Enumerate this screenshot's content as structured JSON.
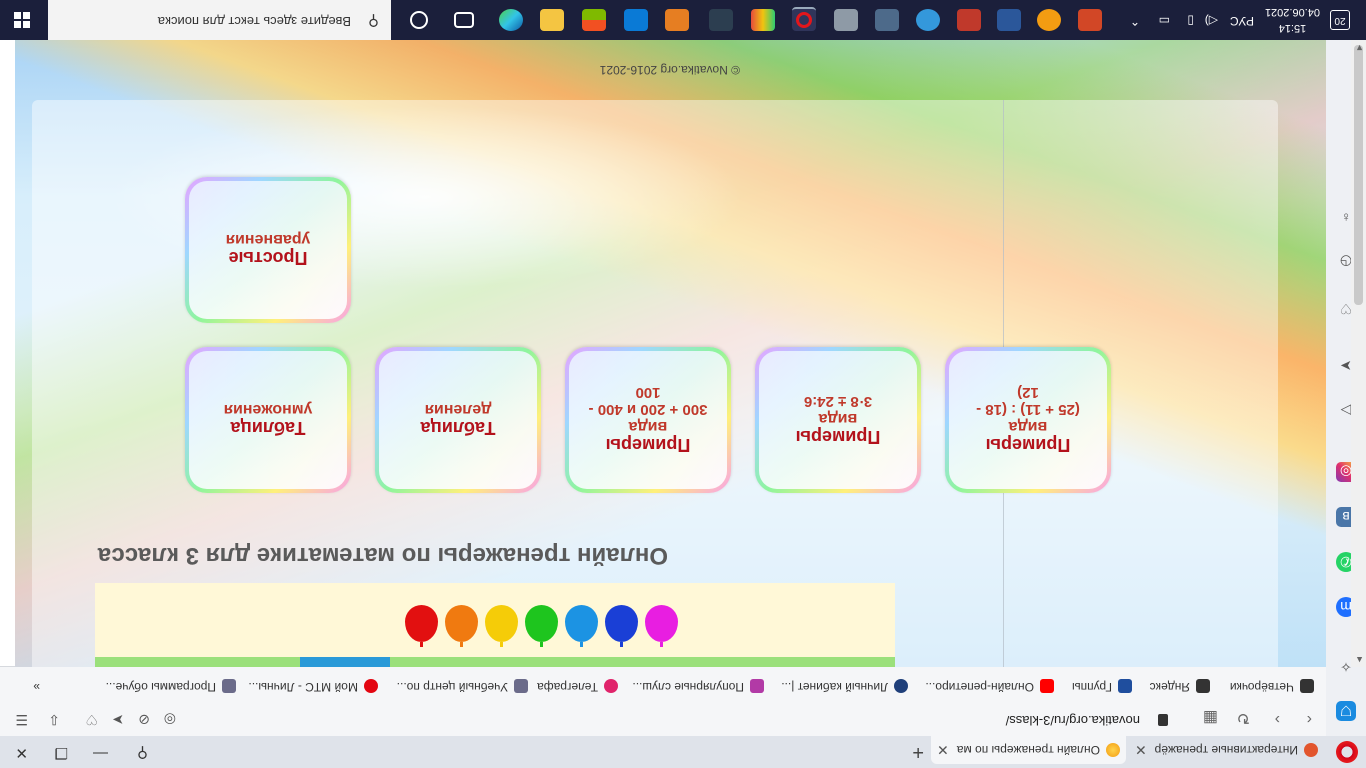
{
  "browser": {
    "tabs": [
      {
        "label": "Интерактивные тренажёр"
      },
      {
        "label": "Онлайн тренажеры по ма"
      }
    ],
    "url": "novatika.org/ru/3-klass/",
    "bookmarks": [
      {
        "label": "Четвёрочки",
        "color": "#333333"
      },
      {
        "label": "Яндекс",
        "color": "#333333"
      },
      {
        "label": "Группы",
        "color": "#1f4e9e"
      },
      {
        "label": "Онлайн-репетиро...",
        "color": "#ff0000"
      },
      {
        "label": "Личный кабинет |...",
        "color": "#1f3f7a"
      },
      {
        "label": "Популярные слуш...",
        "color": "#b23aa6"
      },
      {
        "label": "Телеграфа",
        "color": "#e0246b"
      },
      {
        "label": "Учебный центр по...",
        "color": "#6b6b8a"
      },
      {
        "label": "Мой МТС - Личны...",
        "color": "#e30611"
      },
      {
        "label": "Программы обуче...",
        "color": "#6b6b8a"
      }
    ]
  },
  "page": {
    "title": "Онлайн тренажеры по математике для 3 класса",
    "cards_row1": [
      {
        "title": "Примеры",
        "sub1": "вида",
        "sub2": "(25 + 11) : (18 -",
        "sub3": "12)"
      },
      {
        "title": "Примеры",
        "sub1": "вида",
        "sub2": "3·8 ± 24:6",
        "sub3": ""
      },
      {
        "title": "Примеры",
        "sub1": "вида",
        "sub2": "300 + 200 и 400 -",
        "sub3": "100"
      },
      {
        "title": "Таблица",
        "sub1": "деления",
        "sub2": "",
        "sub3": ""
      },
      {
        "title": "Таблица",
        "sub1": "умножения",
        "sub2": "",
        "sub3": ""
      }
    ],
    "cards_row2": [
      {
        "title": "Простые",
        "sub1": "уравнения"
      }
    ],
    "balloon_colors": [
      "#e21010",
      "#f07a10",
      "#f5cc08",
      "#1ec51e",
      "#1c93e3",
      "#1a3fd6",
      "#e81ee1"
    ],
    "copyright": "© Novatika.org 2016-2021"
  },
  "taskbar": {
    "search_placeholder": "Введите здесь текст для поиска",
    "lang": "РУС",
    "time": "15:14",
    "date": "04.06.2021",
    "notifications": "20"
  }
}
